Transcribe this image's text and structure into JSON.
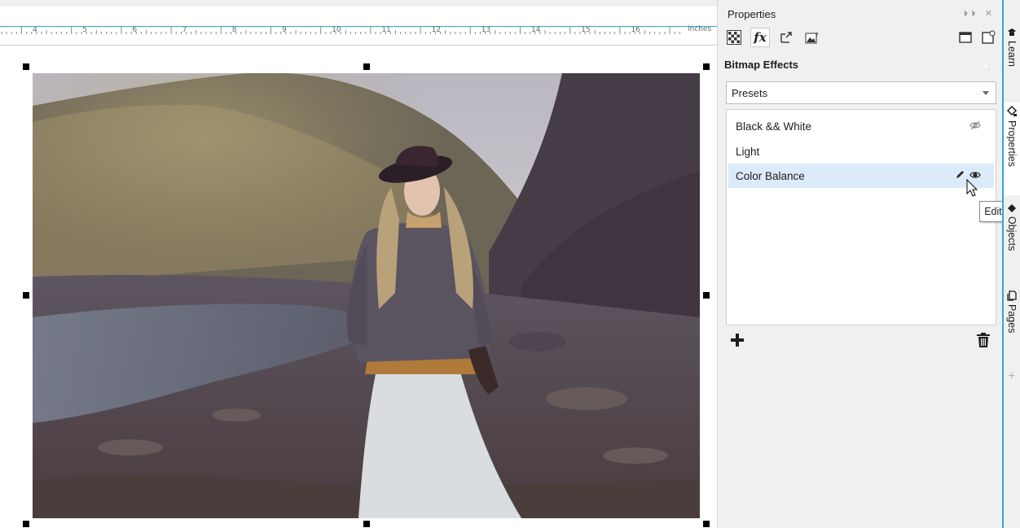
{
  "ruler": {
    "numbers": [
      "4",
      "5",
      "6",
      "7",
      "8",
      "9",
      "10",
      "11",
      "12",
      "13",
      "14",
      "15",
      "16"
    ],
    "unit": "inches"
  },
  "panel": {
    "title": "Properties",
    "window_controls": "⏵⏵ ✕",
    "section_title": "Bitmap Effects",
    "presets_value": "Presets",
    "effects": [
      {
        "label": "Black && White",
        "visible": false,
        "selected": false
      },
      {
        "label": "Light",
        "visible": true,
        "selected": false
      },
      {
        "label": "Color Balance",
        "visible": true,
        "selected": true
      }
    ],
    "tooltip": "Edit",
    "toolbar_icons": [
      "checker-fill-icon",
      "effects-fx-icon",
      "transform-icon",
      "bitmap-icon",
      "frame-icon",
      "page-settings-icon"
    ]
  },
  "side_tabs": {
    "items": [
      "Learn",
      "Properties",
      "Objects",
      "Pages"
    ],
    "active": "Properties"
  },
  "colors": {
    "accent": "#2aa9d6",
    "selection": "#dcebfa",
    "panel_bg": "#f0f0f0"
  }
}
